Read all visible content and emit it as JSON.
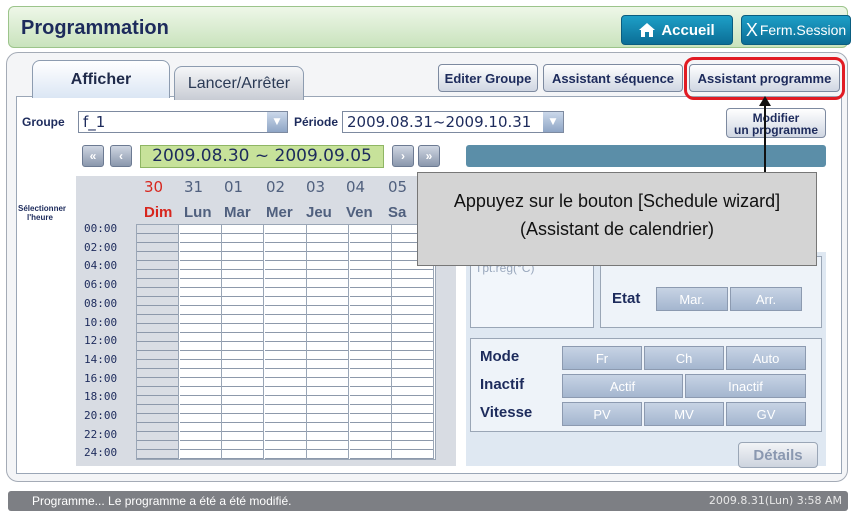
{
  "app": {
    "title": "Programmation"
  },
  "header": {
    "home_label": "Accueil",
    "logout_label": "Ferm.Session",
    "logout_icon": "X"
  },
  "tabs": [
    {
      "label": "Afficher"
    },
    {
      "label": "Lancer/Arrêter"
    }
  ],
  "toolbar": {
    "edit_group": "Editer Groupe",
    "sequence_wizard": "Assistant séquence",
    "program_wizard": "Assistant programme"
  },
  "filters": {
    "group_label": "Groupe",
    "group_value": "f_1",
    "period_label": "Période",
    "period_value": "2009.08.31~2009.10.31"
  },
  "modify_button": {
    "line1": "Modifier",
    "line2": "un programme"
  },
  "week": {
    "range": "2009.08.30 ~ 2009.09.05",
    "select_time": "Sélectionner l'heure",
    "day_numbers": [
      "30",
      "31",
      "01",
      "02",
      "03",
      "04",
      "05"
    ],
    "day_names": [
      "Dim",
      "Lun",
      "Mar",
      "Mer",
      "Jeu",
      "Ven",
      "Sa"
    ],
    "hours": [
      "00:00",
      "02:00",
      "04:00",
      "06:00",
      "08:00",
      "10:00",
      "12:00",
      "14:00",
      "16:00",
      "18:00",
      "20:00",
      "22:00",
      "24:00"
    ]
  },
  "right_panel": {
    "setpoint_label": "Tpt.reg(°C)",
    "state_label": "Etat",
    "state_on": "Mar.",
    "state_off": "Arr.",
    "mode_label": "Mode",
    "mode_options": [
      "Fr",
      "Ch",
      "Auto"
    ],
    "idle_label": "Inactif",
    "idle_options": [
      "Actif",
      "Inactif"
    ],
    "speed_label": "Vitesse",
    "speed_options": [
      "PV",
      "MV",
      "GV"
    ],
    "details_label": "Détails"
  },
  "callout": {
    "line1": "Appuyez sur le bouton [Schedule wizard]",
    "line2": "(Assistant de calendrier)"
  },
  "status": {
    "message": "Programme... Le programme a été a été modifié.",
    "datetime": "2009.8.31(Lun)  3:58 AM"
  },
  "colors": {
    "highlight": "#e11b23",
    "sunday": "#d7261e",
    "header_green": "#c9e3bd",
    "button_blue": "#0b6e96"
  }
}
